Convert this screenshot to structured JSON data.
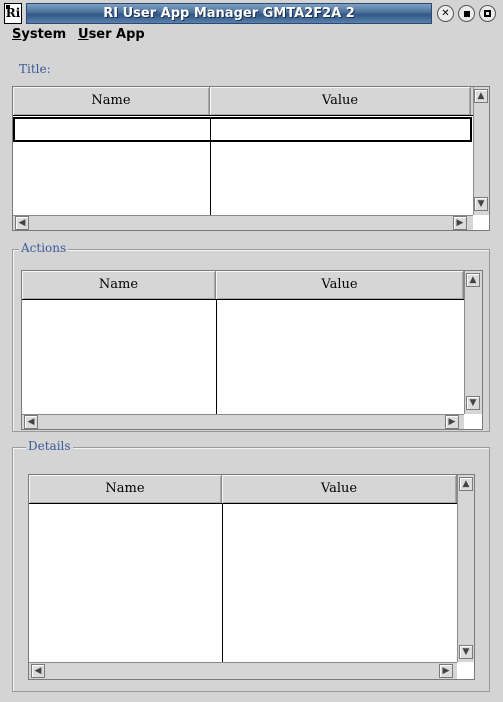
{
  "window": {
    "title": "RI User App Manager GMTA2F2A 2",
    "app_icon_glyph": "Ri",
    "buttons": [
      "close-icon",
      "minimize-icon",
      "maximize-icon"
    ]
  },
  "menu": {
    "system": {
      "first": "S",
      "rest": "ystem"
    },
    "user_app": {
      "first": "U",
      "rest": "ser App"
    }
  },
  "sections": {
    "title": {
      "label": "Title:",
      "col_name": "Name",
      "col_value": "Value"
    },
    "actions": {
      "label": "Actions",
      "col_name": "Name",
      "col_value": "Value"
    },
    "details": {
      "label": "Details",
      "col_name": "Name",
      "col_value": "Value"
    }
  },
  "icons": {
    "arrow_up": "▲",
    "arrow_down": "▼",
    "arrow_left": "◀",
    "arrow_right": "▶",
    "close": "✕"
  }
}
